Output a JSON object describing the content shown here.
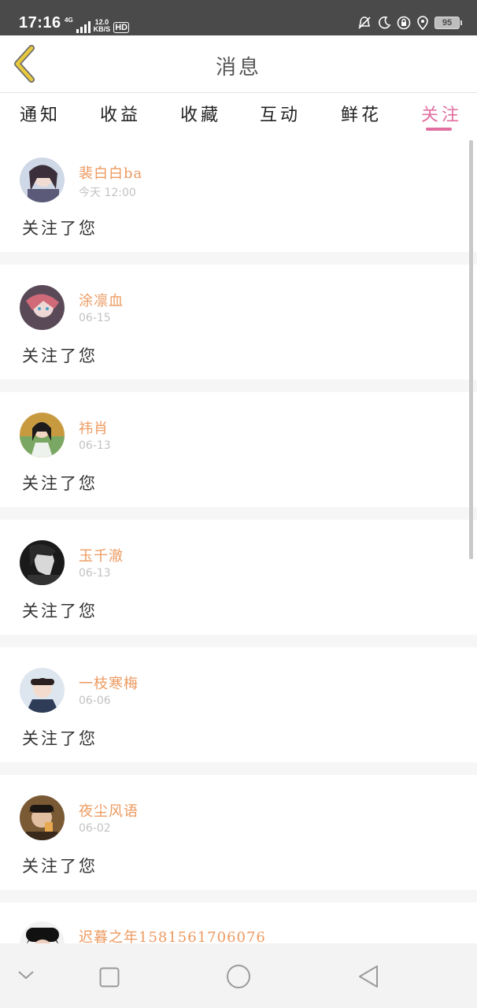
{
  "status_bar": {
    "time": "17:16",
    "network_type": "4G",
    "speed_value": "12.0",
    "speed_unit": "KB/S",
    "hd": "HD",
    "battery": "95"
  },
  "header": {
    "title": "消息"
  },
  "tabs": [
    {
      "label": "通知",
      "active": false
    },
    {
      "label": "收益",
      "active": false
    },
    {
      "label": "收藏",
      "active": false
    },
    {
      "label": "互动",
      "active": false
    },
    {
      "label": "鲜花",
      "active": false
    },
    {
      "label": "关注",
      "active": true
    }
  ],
  "messages": [
    {
      "name": "裴白白ba",
      "time": "今天 12:00",
      "text": "关注了您"
    },
    {
      "name": "涂凛血",
      "time": "06-15",
      "text": "关注了您"
    },
    {
      "name": "祎肖",
      "time": "06-13",
      "text": "关注了您"
    },
    {
      "name": "玉千澈",
      "time": "06-13",
      "text": "关注了您"
    },
    {
      "name": "一枝寒梅",
      "time": "06-06",
      "text": "关注了您"
    },
    {
      "name": "夜尘风语",
      "time": "06-02",
      "text": "关注了您"
    },
    {
      "name": "迟暮之年1581561706076",
      "time": "",
      "text": ""
    }
  ],
  "colors": {
    "accent": "#e06fa0",
    "username": "#ec9a61",
    "back_icon": "#e8c93e"
  },
  "icons": {
    "back": "chevron-left-icon",
    "nav_back": "triangle-back-icon",
    "nav_home": "circle-home-icon",
    "nav_recent": "square-recents-icon",
    "nav_hide": "chevron-down-icon"
  }
}
